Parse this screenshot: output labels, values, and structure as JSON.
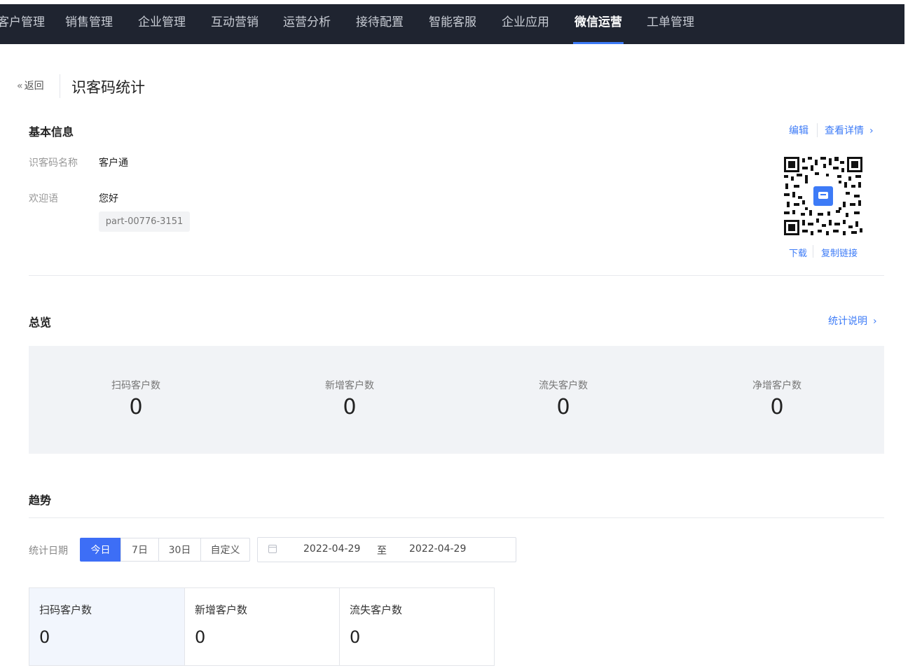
{
  "nav": {
    "items": [
      "客户管理",
      "销售管理",
      "企业管理",
      "互动营销",
      "运营分析",
      "接待配置",
      "智能客服",
      "企业应用",
      "微信运营",
      "工单管理"
    ],
    "active": "微信运营"
  },
  "header": {
    "back_label": "返回",
    "title": "识客码统计"
  },
  "basic_info": {
    "title": "基本信息",
    "edit_label": "编辑",
    "detail_label": "查看详情",
    "name_label": "识客码名称",
    "name_value": "客户通",
    "welcome_label": "欢迎语",
    "welcome_value": "您好",
    "tag": "part-00776-3151",
    "download_label": "下载",
    "copy_link_label": "复制链接"
  },
  "overview": {
    "title": "总览",
    "explain_label": "统计说明",
    "stats": [
      {
        "label": "扫码客户数",
        "value": "0"
      },
      {
        "label": "新增客户数",
        "value": "0"
      },
      {
        "label": "流失客户数",
        "value": "0"
      },
      {
        "label": "净增客户数",
        "value": "0"
      }
    ]
  },
  "trend": {
    "title": "趋势",
    "date_label": "统计日期",
    "ranges": [
      "今日",
      "7日",
      "30日",
      "自定义"
    ],
    "active_range": "今日",
    "start_date": "2022-04-29",
    "to_label": "至",
    "end_date": "2022-04-29",
    "cards": [
      {
        "label": "扫码客户数",
        "value": "0"
      },
      {
        "label": "新增客户数",
        "value": "0"
      },
      {
        "label": "流失客户数",
        "value": "0"
      }
    ]
  },
  "colors": {
    "accent": "#3d6ef6",
    "nav_bg": "#1f2430",
    "link": "#3d7bf7"
  },
  "icons": [
    "double-chevron-left-icon",
    "chevron-right-icon",
    "calendar-icon",
    "qr-code-icon"
  ]
}
